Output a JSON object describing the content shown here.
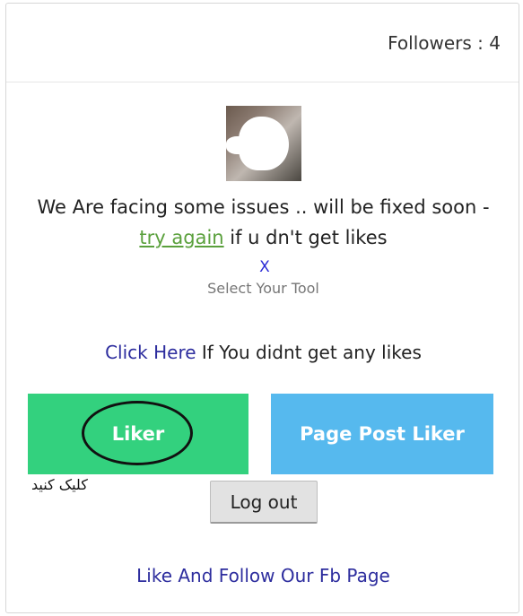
{
  "header": {
    "followers": "Followers : 4"
  },
  "notice": {
    "before_link": "We Are facing some issues .. will be fixed soon - ",
    "link": "try again",
    "after_link": " if u dn't get likes"
  },
  "close_label": "X",
  "select_tool": "Select Your Tool",
  "click_here": {
    "link": "Click Here",
    "rest": " If You didnt get any likes"
  },
  "tools": {
    "liker_label": "Liker",
    "page_post_liker_label": "Page Post Liker"
  },
  "annotation_text": "کلیک کنید",
  "logout_label": "Log out",
  "fb_page_link": "Like And Follow Our Fb Page",
  "colors": {
    "liker_bg": "#33d17e",
    "page_post_bg": "#56b9ee",
    "link_blue": "#2d2d9e",
    "link_green": "#5aa03c"
  }
}
